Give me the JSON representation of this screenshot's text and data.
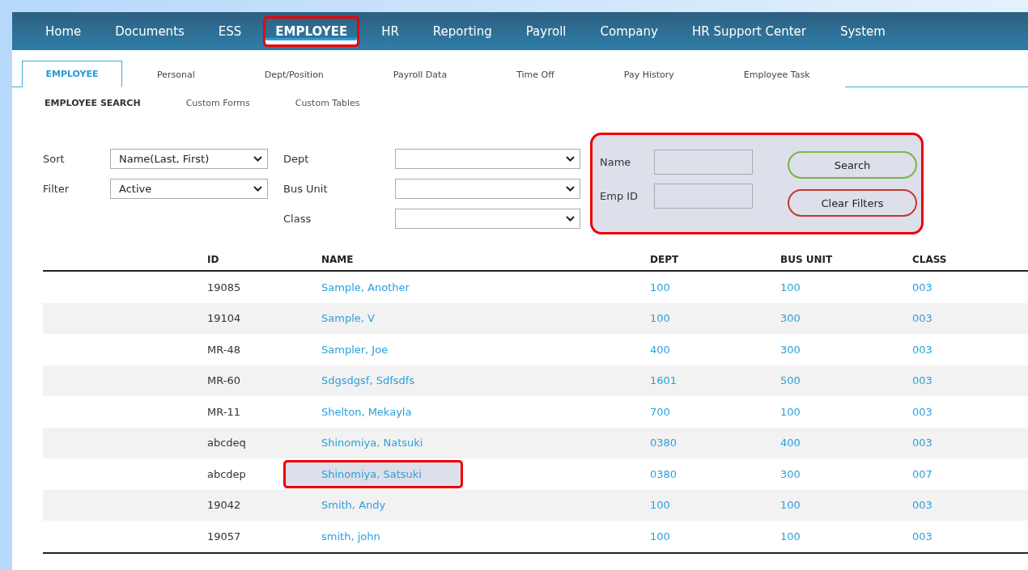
{
  "nav": [
    {
      "label": "Home",
      "selected": false,
      "highlighted": false
    },
    {
      "label": "Documents",
      "selected": false,
      "highlighted": false
    },
    {
      "label": "ESS",
      "selected": false,
      "highlighted": false
    },
    {
      "label": "EMPLOYEE",
      "selected": true,
      "highlighted": true
    },
    {
      "label": "HR",
      "selected": false,
      "highlighted": false
    },
    {
      "label": "Reporting",
      "selected": false,
      "highlighted": false
    },
    {
      "label": "Payroll",
      "selected": false,
      "highlighted": false
    },
    {
      "label": "Company",
      "selected": false,
      "highlighted": false
    },
    {
      "label": "HR Support Center",
      "selected": false,
      "highlighted": false
    },
    {
      "label": "System",
      "selected": false,
      "highlighted": false
    }
  ],
  "tabs": [
    {
      "label": "EMPLOYEE",
      "selected": true
    },
    {
      "label": "Personal",
      "selected": false
    },
    {
      "label": "Dept/Position",
      "selected": false
    },
    {
      "label": "Payroll Data",
      "selected": false
    },
    {
      "label": "Time Off",
      "selected": false
    },
    {
      "label": "Pay History",
      "selected": false
    },
    {
      "label": "Employee Task",
      "selected": false
    }
  ],
  "subtabs": [
    {
      "label": "EMPLOYEE SEARCH",
      "selected": true
    },
    {
      "label": "Custom Forms",
      "selected": false
    },
    {
      "label": "Custom Tables",
      "selected": false
    }
  ],
  "filters_left": [
    {
      "label": "Sort",
      "value": "Name(Last, First)"
    },
    {
      "label": "Filter",
      "value": "Active"
    }
  ],
  "filters_mid": [
    {
      "label": "Dept"
    },
    {
      "label": "Bus Unit"
    },
    {
      "label": "Class"
    }
  ],
  "search_panel": {
    "highlighted": true,
    "fields": [
      {
        "label": "Name"
      },
      {
        "label": "Emp ID"
      }
    ],
    "buttons": [
      {
        "label": "Search",
        "kind": "primary"
      },
      {
        "label": "Clear Filters",
        "kind": "danger"
      }
    ]
  },
  "table": {
    "columns": [
      "ID",
      "NAME",
      "DEPT",
      "BUS UNIT",
      "CLASS"
    ],
    "rows": [
      {
        "cells": [
          "19085",
          "Sample, Another",
          "100",
          "100",
          "003"
        ],
        "highlighted": false
      },
      {
        "cells": [
          "19104",
          "Sample, V",
          "100",
          "300",
          "003"
        ],
        "highlighted": false
      },
      {
        "cells": [
          "MR-48",
          "Sampler, Joe",
          "400",
          "300",
          "003"
        ],
        "highlighted": false
      },
      {
        "cells": [
          "MR-60",
          "Sdgsdgsf, Sdfsdfs",
          "1601",
          "500",
          "003"
        ],
        "highlighted": false
      },
      {
        "cells": [
          "MR-11",
          "Shelton, Mekayla",
          "700",
          "100",
          "003"
        ],
        "highlighted": false
      },
      {
        "cells": [
          "abcdeq",
          "Shinomiya, Natsuki",
          "0380",
          "400",
          "003"
        ],
        "highlighted": false
      },
      {
        "cells": [
          "abcdep",
          "Shinomiya, Satsuki",
          "0380",
          "300",
          "007"
        ],
        "highlighted": true
      },
      {
        "cells": [
          "19042",
          "Smith, Andy",
          "100",
          "100",
          "003"
        ],
        "highlighted": false
      },
      {
        "cells": [
          "19057",
          "smith, john",
          "100",
          "100",
          "003"
        ],
        "highlighted": false
      }
    ]
  }
}
